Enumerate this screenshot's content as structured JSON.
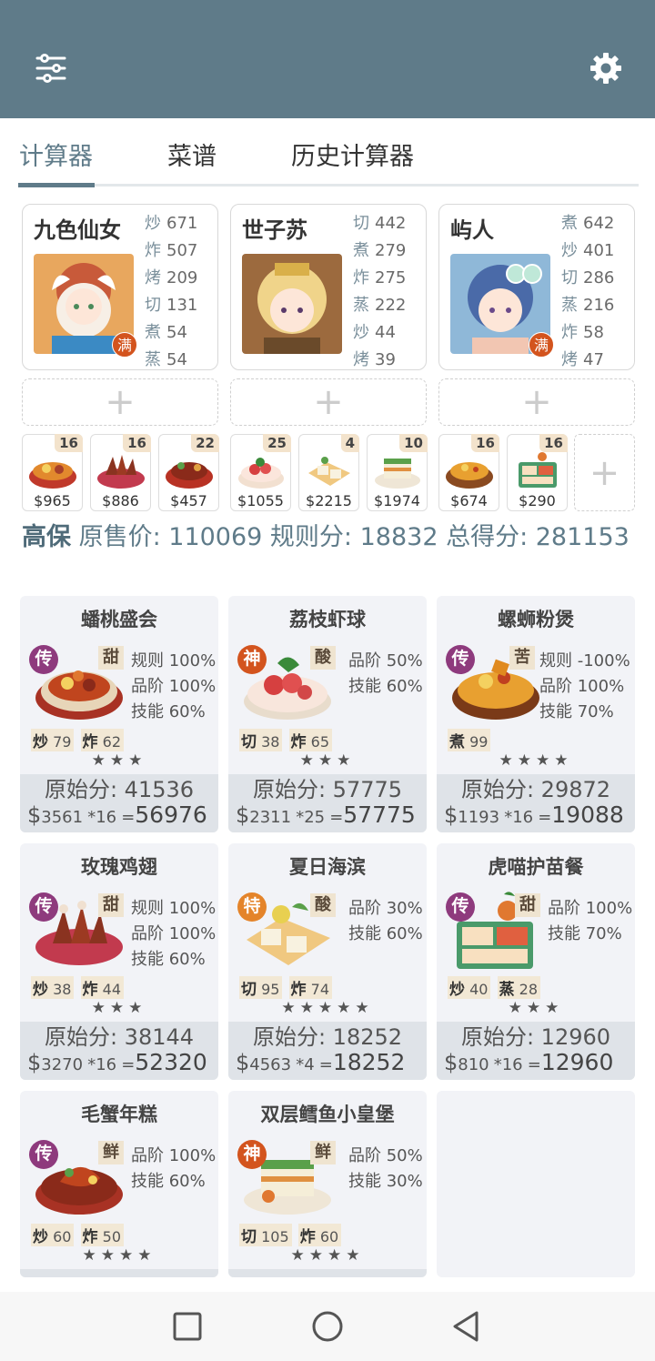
{
  "header": {
    "menu_icon": "sliders-icon",
    "settings_icon": "gear-icon"
  },
  "tabs": [
    "计算器",
    "菜谱",
    "历史计算器"
  ],
  "colors": {
    "header": "#5f7b89",
    "chuan": "#8e3a7d",
    "shen": "#d3541e",
    "te": "#e4842a",
    "man_badge": "#d3541e"
  },
  "chefs": [
    {
      "name": "九色仙女",
      "badge": "满",
      "skills": [
        [
          "炒",
          "671"
        ],
        [
          "炸",
          "507"
        ],
        [
          "烤",
          "209"
        ],
        [
          "切",
          "131"
        ],
        [
          "煮",
          "54"
        ],
        [
          "蒸",
          "54"
        ]
      ]
    },
    {
      "name": "世子苏",
      "badge": "",
      "skills": [
        [
          "切",
          "442"
        ],
        [
          "煮",
          "279"
        ],
        [
          "炸",
          "275"
        ],
        [
          "蒸",
          "222"
        ],
        [
          "炒",
          "44"
        ],
        [
          "烤",
          "39"
        ]
      ]
    },
    {
      "name": "屿人",
      "badge": "满",
      "skills": [
        [
          "煮",
          "642"
        ],
        [
          "炒",
          "401"
        ],
        [
          "切",
          "286"
        ],
        [
          "蒸",
          "216"
        ],
        [
          "炸",
          "58"
        ],
        [
          "烤",
          "47"
        ]
      ]
    }
  ],
  "empty_slot_glyph": "+",
  "dishes": [
    {
      "count": "16",
      "price": "$965"
    },
    {
      "count": "16",
      "price": "$886"
    },
    {
      "count": "22",
      "price": "$457"
    },
    {
      "count": "25",
      "price": "$1055"
    },
    {
      "count": "4",
      "price": "$2215"
    },
    {
      "count": "10",
      "price": "$1974"
    },
    {
      "count": "16",
      "price": "$674"
    },
    {
      "count": "16",
      "price": "$290"
    }
  ],
  "summary": {
    "name": "高保",
    "text": "原售价:  110069 规则分:  18832 总得分:  281153"
  },
  "recipes": [
    {
      "title": "蟠桃盛会",
      "rarity": "传",
      "flavor": "甜",
      "stats": [
        "规则 100%",
        "品阶 100%",
        "技能 60%"
      ],
      "req": [
        [
          "炒",
          "79"
        ],
        [
          "炸",
          "62"
        ]
      ],
      "stars": "★★★",
      "orig": "原始分: 41536",
      "price": "3561",
      "mult": "*16",
      "final": "56976"
    },
    {
      "title": "荔枝虾球",
      "rarity": "神",
      "flavor": "酸",
      "stats": [
        "品阶 50%",
        "技能 60%"
      ],
      "req": [
        [
          "切",
          "38"
        ],
        [
          "炸",
          "65"
        ]
      ],
      "stars": "★★★",
      "orig": "原始分: 57775",
      "price": "2311",
      "mult": "*25",
      "final": "57775"
    },
    {
      "title": "螺蛳粉煲",
      "rarity": "传",
      "flavor": "苦",
      "stats": [
        "规则 -100%",
        "品阶 100%",
        "技能 70%"
      ],
      "req": [
        [
          "煮",
          "99"
        ]
      ],
      "stars": "★★★★",
      "orig": "原始分: 29872",
      "price": "1193",
      "mult": "*16",
      "final": "19088"
    },
    {
      "title": "玫瑰鸡翅",
      "rarity": "传",
      "flavor": "甜",
      "stats": [
        "规则 100%",
        "品阶 100%",
        "技能 60%"
      ],
      "req": [
        [
          "炒",
          "38"
        ],
        [
          "炸",
          "44"
        ]
      ],
      "stars": "★★★",
      "orig": "原始分: 38144",
      "price": "3270",
      "mult": "*16",
      "final": "52320"
    },
    {
      "title": "夏日海滨",
      "rarity": "特",
      "flavor": "酸",
      "stats": [
        "品阶 30%",
        "技能 60%"
      ],
      "req": [
        [
          "切",
          "95"
        ],
        [
          "炸",
          "74"
        ]
      ],
      "stars": "★★★★★",
      "orig": "原始分: 18252",
      "price": "4563",
      "mult": "*4",
      "final": "18252"
    },
    {
      "title": "虎喵护苗餐",
      "rarity": "传",
      "flavor": "甜",
      "stats": [
        "品阶 100%",
        "技能 70%"
      ],
      "req": [
        [
          "炒",
          "40"
        ],
        [
          "蒸",
          "28"
        ]
      ],
      "stars": "★★★",
      "orig": "原始分: 12960",
      "price": "810",
      "mult": "*16",
      "final": "12960"
    },
    {
      "title": "毛蟹年糕",
      "rarity": "传",
      "flavor": "鲜",
      "stats": [
        "品阶 100%",
        "技能 60%"
      ],
      "req": [
        [
          "炒",
          "60"
        ],
        [
          "炸",
          "50"
        ]
      ],
      "stars": "★★★★",
      "orig": "",
      "price": "",
      "mult": "",
      "final": ""
    },
    {
      "title": "双层鳕鱼小皇堡",
      "rarity": "神",
      "flavor": "鲜",
      "stats": [
        "品阶 50%",
        "技能 30%"
      ],
      "req": [
        [
          "切",
          "105"
        ],
        [
          "炸",
          "60"
        ]
      ],
      "stars": "★★★★",
      "orig": "",
      "price": "",
      "mult": "",
      "final": ""
    }
  ],
  "navbar": [
    "square-nav-icon",
    "circle-nav-icon",
    "triangle-back-icon"
  ]
}
